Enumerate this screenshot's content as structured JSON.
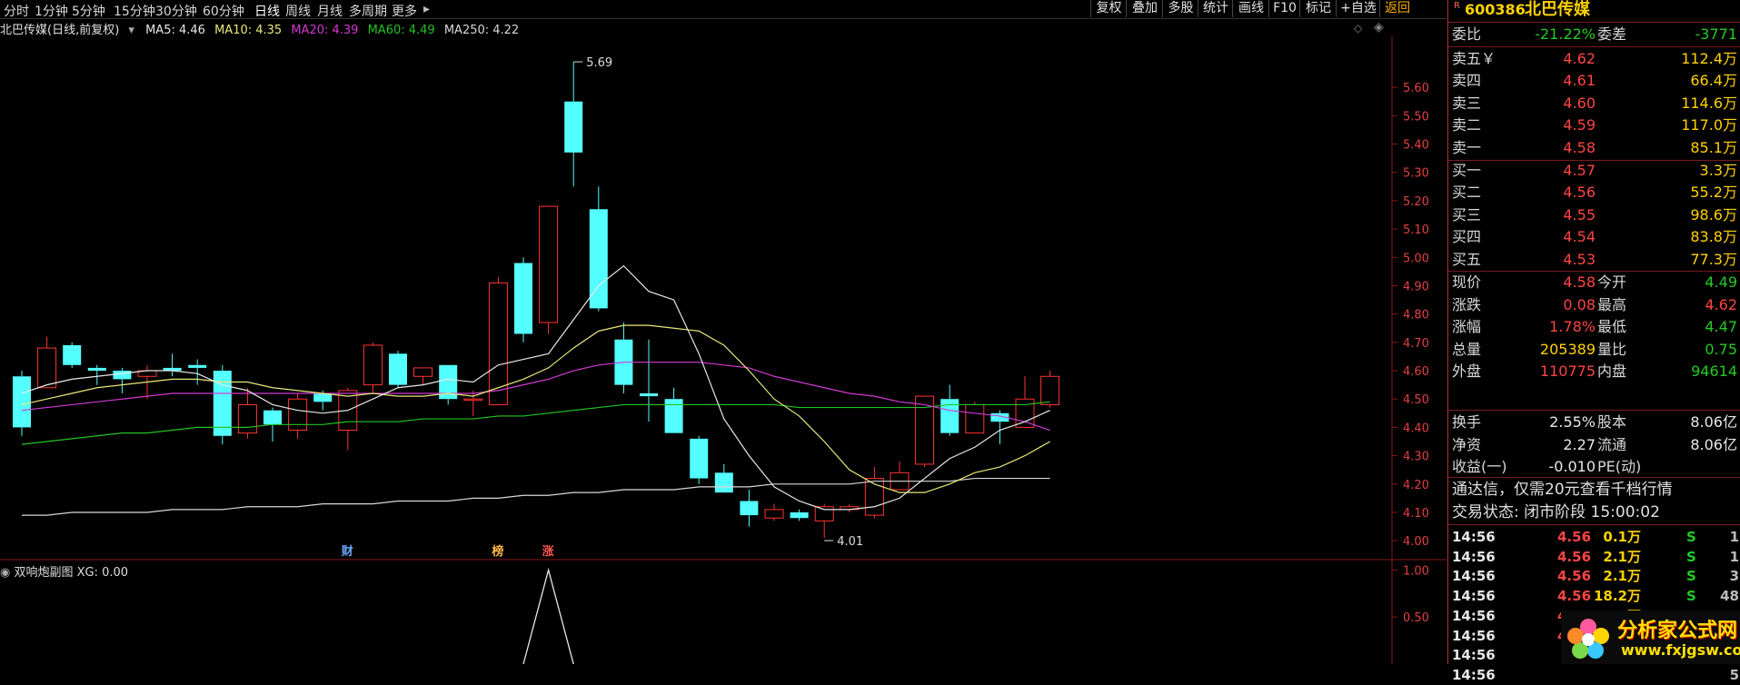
{
  "tabs": [
    {
      "label": "分时",
      "active": false
    },
    {
      "label": "1分钟",
      "active": false
    },
    {
      "label": "5分钟",
      "active": false
    },
    {
      "label": "15分钟",
      "active": false
    },
    {
      "label": "30分钟",
      "active": false
    },
    {
      "label": "60分钟",
      "active": false
    },
    {
      "label": "日线",
      "active": true
    },
    {
      "label": "周线",
      "active": false
    },
    {
      "label": "月线",
      "active": false
    },
    {
      "label": "多周期",
      "active": false
    },
    {
      "label": "更多",
      "active": false
    }
  ],
  "toolbar_right": [
    "复权",
    "叠加",
    "多股",
    "统计",
    "画线",
    "F10",
    "标记",
    "+自选",
    "返回"
  ],
  "chart_title": "北巴传媒(日线,前复权)",
  "ma_labels": {
    "ma5": "MA5: 4.46",
    "ma10": "MA10: 4.35",
    "ma20": "MA20: 4.39",
    "ma60": "MA60: 4.49",
    "ma250": "MA250: 4.22"
  },
  "colors": {
    "up": "#ff3333",
    "down": "#54ffff",
    "ma5": "#e8e8e8",
    "ma10": "#e8e87a",
    "ma20": "#d23ad2",
    "ma60": "#22c422",
    "ma250": "#d8d8d8",
    "axis": "#8b1a1a"
  },
  "annotations": {
    "high": "5.69",
    "low": "4.01",
    "markers": [
      "财",
      "榜",
      "涨"
    ]
  },
  "sub_title": "双响炮副图 XG: 0.00",
  "chart_data": {
    "type": "candlestick",
    "ylim": [
      3.93,
      5.78
    ],
    "yticks": [
      "5.60",
      "5.50",
      "5.40",
      "5.30",
      "5.20",
      "5.10",
      "5.00",
      "4.90",
      "4.80",
      "4.70",
      "4.60",
      "4.50",
      "4.40",
      "4.30",
      "4.20",
      "4.10",
      "4.00"
    ],
    "candles": [
      {
        "o": 4.58,
        "h": 4.6,
        "l": 4.37,
        "c": 4.4
      },
      {
        "o": 4.54,
        "h": 4.72,
        "l": 4.54,
        "c": 4.68
      },
      {
        "o": 4.69,
        "h": 4.7,
        "l": 4.61,
        "c": 4.62
      },
      {
        "o": 4.61,
        "h": 4.62,
        "l": 4.55,
        "c": 4.6
      },
      {
        "o": 4.6,
        "h": 4.61,
        "l": 4.52,
        "c": 4.57
      },
      {
        "o": 4.58,
        "h": 4.62,
        "l": 4.5,
        "c": 4.6
      },
      {
        "o": 4.61,
        "h": 4.66,
        "l": 4.58,
        "c": 4.6
      },
      {
        "o": 4.62,
        "h": 4.64,
        "l": 4.55,
        "c": 4.61
      },
      {
        "o": 4.6,
        "h": 4.62,
        "l": 4.34,
        "c": 4.37
      },
      {
        "o": 4.38,
        "h": 4.54,
        "l": 4.36,
        "c": 4.48
      },
      {
        "o": 4.46,
        "h": 4.47,
        "l": 4.35,
        "c": 4.41
      },
      {
        "o": 4.39,
        "h": 4.52,
        "l": 4.36,
        "c": 4.5
      },
      {
        "o": 4.52,
        "h": 4.53,
        "l": 4.46,
        "c": 4.49
      },
      {
        "o": 4.39,
        "h": 4.54,
        "l": 4.32,
        "c": 4.53
      },
      {
        "o": 4.55,
        "h": 4.7,
        "l": 4.52,
        "c": 4.69
      },
      {
        "o": 4.66,
        "h": 4.67,
        "l": 4.54,
        "c": 4.55
      },
      {
        "o": 4.58,
        "h": 4.61,
        "l": 4.55,
        "c": 4.61
      },
      {
        "o": 4.62,
        "h": 4.62,
        "l": 4.48,
        "c": 4.5
      },
      {
        "o": 4.5,
        "h": 4.53,
        "l": 4.44,
        "c": 4.5
      },
      {
        "o": 4.48,
        "h": 4.93,
        "l": 4.48,
        "c": 4.91
      },
      {
        "o": 4.98,
        "h": 5.0,
        "l": 4.7,
        "c": 4.73
      },
      {
        "o": 4.77,
        "h": 5.18,
        "l": 4.73,
        "c": 5.18
      },
      {
        "o": 5.55,
        "h": 5.69,
        "l": 5.25,
        "c": 5.37
      },
      {
        "o": 5.17,
        "h": 5.25,
        "l": 4.81,
        "c": 4.82
      },
      {
        "o": 4.71,
        "h": 4.77,
        "l": 4.52,
        "c": 4.55
      },
      {
        "o": 4.52,
        "h": 4.71,
        "l": 4.42,
        "c": 4.51
      },
      {
        "o": 4.5,
        "h": 4.54,
        "l": 4.38,
        "c": 4.38
      },
      {
        "o": 4.36,
        "h": 4.37,
        "l": 4.2,
        "c": 4.22
      },
      {
        "o": 4.24,
        "h": 4.27,
        "l": 4.17,
        "c": 4.17
      },
      {
        "o": 4.14,
        "h": 4.18,
        "l": 4.05,
        "c": 4.09
      },
      {
        "o": 4.08,
        "h": 4.13,
        "l": 4.07,
        "c": 4.11
      },
      {
        "o": 4.1,
        "h": 4.11,
        "l": 4.07,
        "c": 4.08
      },
      {
        "o": 4.07,
        "h": 4.13,
        "l": 4.01,
        "c": 4.12
      },
      {
        "o": 4.11,
        "h": 4.13,
        "l": 4.1,
        "c": 4.12
      },
      {
        "o": 4.09,
        "h": 4.26,
        "l": 4.08,
        "c": 4.22
      },
      {
        "o": 4.18,
        "h": 4.28,
        "l": 4.18,
        "c": 4.24
      },
      {
        "o": 4.27,
        "h": 4.51,
        "l": 4.26,
        "c": 4.51
      },
      {
        "o": 4.5,
        "h": 4.55,
        "l": 4.37,
        "c": 4.38
      },
      {
        "o": 4.38,
        "h": 4.49,
        "l": 4.38,
        "c": 4.48
      },
      {
        "o": 4.45,
        "h": 4.46,
        "l": 4.34,
        "c": 4.42
      },
      {
        "o": 4.4,
        "h": 4.58,
        "l": 4.4,
        "c": 4.5
      },
      {
        "o": 4.48,
        "h": 4.6,
        "l": 4.47,
        "c": 4.58
      }
    ],
    "ma5": [
      4.52,
      4.55,
      4.57,
      4.58,
      4.59,
      4.6,
      4.6,
      4.59,
      4.55,
      4.53,
      4.48,
      4.46,
      4.45,
      4.46,
      4.5,
      4.54,
      4.55,
      4.57,
      4.56,
      4.62,
      4.64,
      4.66,
      4.78,
      4.9,
      4.97,
      4.88,
      4.85,
      4.66,
      4.43,
      4.3,
      4.19,
      4.14,
      4.11,
      4.11,
      4.12,
      4.15,
      4.22,
      4.29,
      4.33,
      4.39,
      4.42,
      4.46
    ],
    "ma10": [
      4.48,
      4.5,
      4.52,
      4.54,
      4.55,
      4.56,
      4.57,
      4.57,
      4.56,
      4.56,
      4.54,
      4.53,
      4.52,
      4.51,
      4.52,
      4.51,
      4.51,
      4.52,
      4.51,
      4.54,
      4.57,
      4.61,
      4.68,
      4.74,
      4.76,
      4.76,
      4.75,
      4.74,
      4.69,
      4.6,
      4.5,
      4.44,
      4.35,
      4.25,
      4.2,
      4.17,
      4.17,
      4.2,
      4.24,
      4.26,
      4.3,
      4.35
    ],
    "ma20": [
      4.46,
      4.47,
      4.48,
      4.49,
      4.5,
      4.51,
      4.52,
      4.52,
      4.52,
      4.52,
      4.52,
      4.52,
      4.52,
      4.52,
      4.52,
      4.52,
      4.52,
      4.52,
      4.52,
      4.53,
      4.55,
      4.57,
      4.6,
      4.62,
      4.63,
      4.63,
      4.63,
      4.63,
      4.62,
      4.61,
      4.58,
      4.56,
      4.54,
      4.52,
      4.51,
      4.49,
      4.48,
      4.46,
      4.45,
      4.44,
      4.42,
      4.39
    ],
    "ma60": [
      4.34,
      4.35,
      4.36,
      4.37,
      4.38,
      4.38,
      4.39,
      4.4,
      4.4,
      4.4,
      4.41,
      4.41,
      4.41,
      4.42,
      4.42,
      4.42,
      4.43,
      4.43,
      4.43,
      4.44,
      4.44,
      4.45,
      4.46,
      4.47,
      4.48,
      4.48,
      4.48,
      4.48,
      4.48,
      4.48,
      4.48,
      4.47,
      4.47,
      4.47,
      4.47,
      4.47,
      4.47,
      4.48,
      4.48,
      4.48,
      4.48,
      4.49
    ],
    "ma250": [
      4.09,
      4.09,
      4.1,
      4.1,
      4.1,
      4.1,
      4.11,
      4.11,
      4.11,
      4.12,
      4.12,
      4.12,
      4.13,
      4.13,
      4.13,
      4.14,
      4.14,
      4.14,
      4.15,
      4.15,
      4.16,
      4.16,
      4.17,
      4.17,
      4.18,
      4.18,
      4.18,
      4.19,
      4.19,
      4.19,
      4.2,
      4.2,
      4.2,
      4.2,
      4.21,
      4.21,
      4.21,
      4.21,
      4.22,
      4.22,
      4.22,
      4.22
    ],
    "sub": {
      "yticks": [
        "1.00",
        "0.50"
      ],
      "ylim": [
        0,
        1.1
      ],
      "spike_index": 21,
      "spike_value": 1.0
    }
  },
  "quote": {
    "market_badge": "R",
    "code": "600386",
    "name": "北巴传媒",
    "weibi_label": "委比",
    "weibi": "-21.22%",
    "weicha_label": "委差",
    "weicha": "-3771",
    "asks": [
      {
        "label": "卖五￥",
        "price": "4.62",
        "vol": "112.4万"
      },
      {
        "label": "卖四",
        "price": "4.61",
        "vol": "66.4万"
      },
      {
        "label": "卖三",
        "price": "4.60",
        "vol": "114.6万"
      },
      {
        "label": "卖二",
        "price": "4.59",
        "vol": "117.0万"
      },
      {
        "label": "卖一",
        "price": "4.58",
        "vol": "85.1万"
      }
    ],
    "bids": [
      {
        "label": "买一",
        "price": "4.57",
        "vol": "3.3万"
      },
      {
        "label": "买二",
        "price": "4.56",
        "vol": "55.2万"
      },
      {
        "label": "买三",
        "price": "4.55",
        "vol": "98.6万"
      },
      {
        "label": "买四",
        "price": "4.54",
        "vol": "83.8万"
      },
      {
        "label": "买五",
        "price": "4.53",
        "vol": "77.3万"
      }
    ],
    "stats": [
      {
        "l1": "现价",
        "v1": "4.58",
        "c1": "red",
        "l2": "今开",
        "v2": "4.49",
        "c2": "green"
      },
      {
        "l1": "涨跌",
        "v1": "0.08",
        "c1": "red",
        "l2": "最高",
        "v2": "4.62",
        "c2": "red"
      },
      {
        "l1": "涨幅",
        "v1": "1.78%",
        "c1": "red",
        "l2": "最低",
        "v2": "4.47",
        "c2": "green"
      },
      {
        "l1": "总量",
        "v1": "205389",
        "c1": "yellow",
        "l2": "量比",
        "v2": "0.75",
        "c2": "green"
      },
      {
        "l1": "外盘",
        "v1": "110775",
        "c1": "red",
        "l2": "内盘",
        "v2": "94614",
        "c2": "green"
      }
    ],
    "stats2": [
      {
        "l1": "换手",
        "v1": "2.55%",
        "l2": "股本",
        "v2": "8.06亿"
      },
      {
        "l1": "净资",
        "v1": "2.27",
        "l2": "流通",
        "v2": "8.06亿"
      },
      {
        "l1": "收益(一)",
        "v1": "-0.010",
        "l2": "PE(动)",
        "v2": ""
      }
    ],
    "notice": "通达信，仅需20元查看千档行情",
    "trade_status": "交易状态: 闭市阶段 15:00:02",
    "ticks": [
      {
        "time": "14:56",
        "price": "4.56",
        "vol": "0.1万",
        "bs": "S",
        "n": "1"
      },
      {
        "time": "14:56",
        "price": "4.56",
        "vol": "2.1万",
        "bs": "S",
        "n": "1"
      },
      {
        "time": "14:56",
        "price": "4.56",
        "vol": "2.1万",
        "bs": "S",
        "n": "3"
      },
      {
        "time": "14:56",
        "price": "4.56",
        "vol": "18.2万",
        "bs": "S",
        "n": "48"
      },
      {
        "time": "14:56",
        "price": "4.57",
        "vol": "11.3万",
        "bs": "B",
        "n": "5"
      },
      {
        "time": "14:56",
        "price": "4.56",
        "vol": "2.1万",
        "bs": "S",
        "n": "1"
      },
      {
        "time": "14:56",
        "price": "",
        "vol": "",
        "bs": "",
        "n": "1"
      },
      {
        "time": "14:56",
        "price": "",
        "vol": "",
        "bs": "",
        "n": "5"
      }
    ]
  },
  "watermark": {
    "title": "分析家公式网",
    "url": "www.fxjgsw.com"
  }
}
